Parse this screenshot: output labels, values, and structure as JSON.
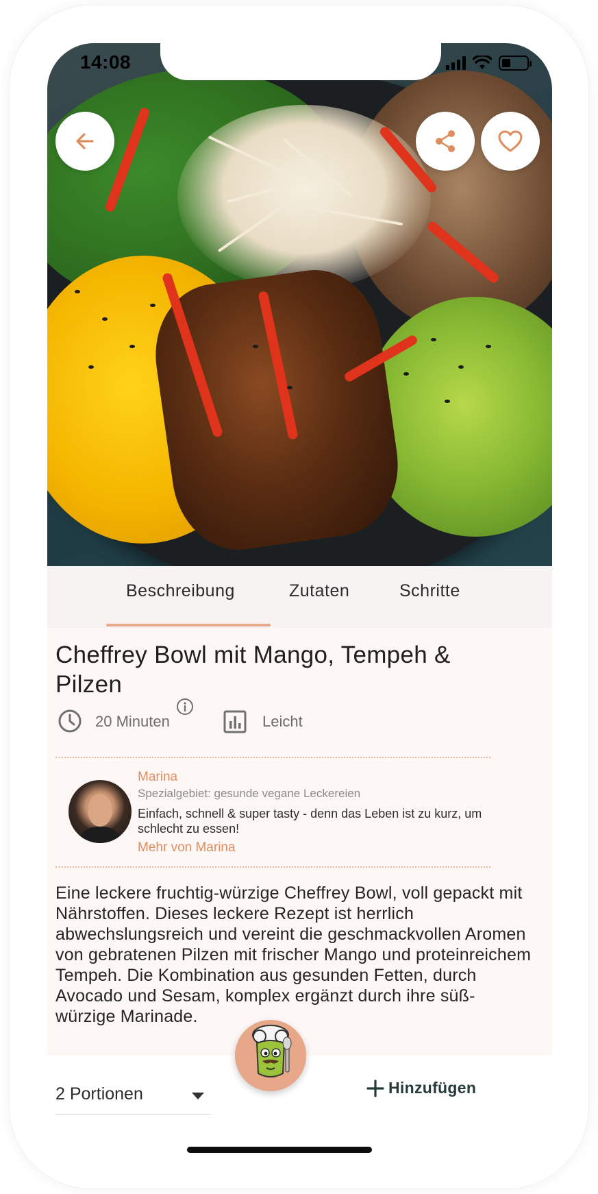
{
  "status_bar": {
    "time": "14:08",
    "battery_level": 0.35
  },
  "hero": {
    "image_alt": "Cheffrey Bowl mit Mango, Tempeh & Pilzen"
  },
  "tabs": [
    {
      "label": "Beschreibung",
      "active": true
    },
    {
      "label": "Zutaten",
      "active": false
    },
    {
      "label": "Schritte",
      "active": false
    }
  ],
  "recipe": {
    "title": "Cheffrey Bowl mit Mango, Tempeh & Pilzen",
    "duration": "20 Minuten",
    "difficulty": "Leicht",
    "description": "Eine leckere fruchtig-würzige Cheffrey Bowl, voll gepackt mit Nährstoffen. Dieses leckere Rezept ist herrlich abwechslungsreich und vereint die geschmackvollen Aromen von gebratenen Pilzen mit frischer Mango und proteinreichem Tempeh. Die Kombination aus gesunden Fetten, durch Avocado und Sesam, komplex ergänzt durch ihre süß-würzige Marinade."
  },
  "author": {
    "name": "Marina",
    "specialty": "Spezialgebiet: gesunde vegane Leckereien",
    "quote": "Einfach, schnell & super tasty - denn das Leben ist zu kurz, um schlecht zu essen!",
    "more_link": "Mehr von Marina"
  },
  "bottom_bar": {
    "portions": "2 Portionen",
    "add_label": "Hinzufügen"
  },
  "colors": {
    "accent": "#e08d5e",
    "tab_indicator": "#e8a98c",
    "add_button": "#243b38",
    "background": "#fdf7f6"
  },
  "icons": {
    "back": "arrow-left-icon",
    "share": "share-icon",
    "favorite": "heart-icon",
    "clock": "clock-icon",
    "info": "info-icon",
    "difficulty": "bar-chart-icon",
    "add": "plus-icon",
    "mascot": "chef-broccoli-mascot-icon"
  }
}
